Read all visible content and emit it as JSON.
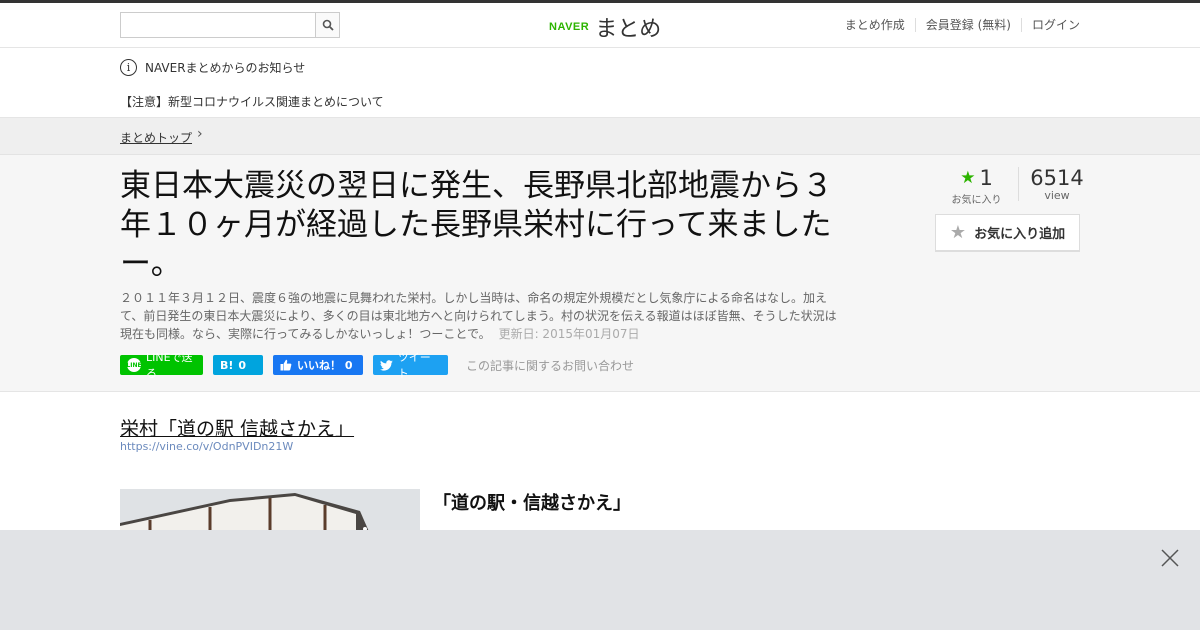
{
  "header": {
    "search_placeholder": "",
    "logo_brand": "NAVER",
    "logo_text": "まとめ",
    "nav": [
      "まとめ作成",
      "会員登録 (無料)",
      "ログイン"
    ]
  },
  "notice": {
    "heading": "NAVERまとめからのお知らせ",
    "item": "【注意】新型コロナウイルス関連まとめについて"
  },
  "breadcrumb": {
    "label": "まとめトップ"
  },
  "article": {
    "title": "東日本大震災の翌日に発生、長野県北部地震から３年１０ヶ月が経過した長野県栄村に行って来ましたー。",
    "description": "２０１１年３月１２日、震度６強の地震に見舞われた栄村。しかし当時は、命名の規定外規模だとし気象庁による命名はなし。加えて、前日発生の東日本大震災により、多くの目は東北地方へと向けられてしまう。村の状況を伝える報道はほぼ皆無、そうした状況は現在も同様。なら、実際に行ってみるしかないっしょ！つーことで。",
    "updated": "更新日: 2015年01月07日",
    "favorites": {
      "count": "1",
      "label": "お気に入り"
    },
    "views": {
      "count": "6514",
      "label": "view"
    },
    "fav_button": "お気に入り追加",
    "share": {
      "line": "LINEで送る",
      "hatena": "0",
      "facebook": "いいね！ 0",
      "twitter": "ツイート",
      "inquiry": "この記事に関するお問い合わせ"
    }
  },
  "content": {
    "section_title": "栄村「道の駅 信越さかえ」",
    "section_url": "https://vine.co/v/OdnPVIDn21W",
    "item_title": "「道の駅・信越さかえ」"
  },
  "colors": {
    "brand_green": "#2db400",
    "line": "#00c300",
    "hatena": "#00a4de",
    "facebook": "#1877f2",
    "twitter": "#1da1f2"
  }
}
